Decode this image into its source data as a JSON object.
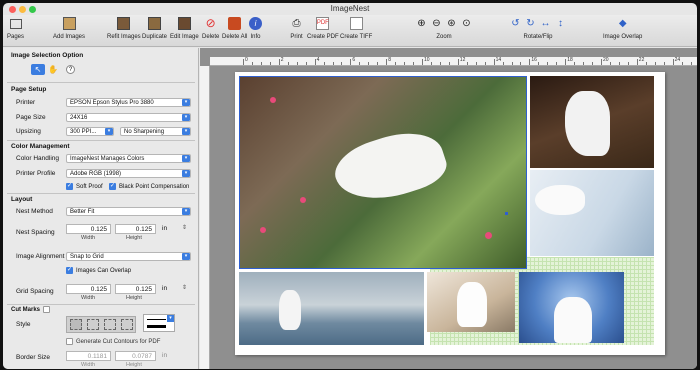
{
  "window": {
    "title": "ImageNest"
  },
  "toolbar": {
    "pages": "Pages",
    "add_images": "Add Images",
    "refit_images": "Refit Images",
    "duplicate": "Duplicate",
    "edit_image": "Edit Image",
    "delete": "Delete",
    "delete_all": "Delete All",
    "info": "Info",
    "print": "Print",
    "create_pdf": "Create PDF",
    "create_tiff": "Create TIFF",
    "zoom": "Zoom",
    "rotate_flip": "Rotate/Flip",
    "image_overlap": "Image Overlap"
  },
  "panel": {
    "image_selection_option": "Image Selection Option",
    "page_setup": "Page Setup",
    "printer_label": "Printer",
    "printer_value": "EPSON Epson Stylus Pro 3880",
    "page_size_label": "Page Size",
    "page_size_value": "24X16",
    "upsizing_label": "Upsizing",
    "upsizing_value": "300 PPI...",
    "sharpening_value": "No Sharpening",
    "color_management": "Color Management",
    "color_handling_label": "Color Handling",
    "color_handling_value": "ImageNest Manages Colors",
    "printer_profile_label": "Printer Profile",
    "printer_profile_value": "Adobe RGB (1998)",
    "soft_proof": "Soft Proof",
    "black_point": "Black Point Compensation",
    "layout": "Layout",
    "nest_method_label": "Nest Method",
    "nest_method_value": "Better Fit",
    "nest_spacing_label": "Nest Spacing",
    "nest_spacing_width": "0.125",
    "nest_spacing_height": "0.125",
    "unit": "in",
    "width_label": "Width",
    "height_label": "Height",
    "image_alignment_label": "Image Alignment",
    "image_alignment_value": "Snap to Grid",
    "images_can_overlap": "Images Can Overlap",
    "grid_spacing_label": "Grid Spacing",
    "grid_spacing_width": "0.125",
    "grid_spacing_height": "0.125",
    "cut_marks": "Cut Marks",
    "style_label": "Style",
    "generate_cut_contours": "Generate Cut Contours for PDF",
    "border_size_label": "Border Size",
    "border_size_width": "0.1181",
    "border_size_height": "0.0787"
  },
  "ruler": {
    "marks": [
      "0",
      "2",
      "4",
      "6",
      "8",
      "10",
      "12",
      "14",
      "16",
      "18",
      "20",
      "22",
      "24"
    ]
  },
  "colors": {
    "accent": "#3b7de0",
    "grid": "#c5e3b0",
    "selection": "#2f5fd0"
  }
}
